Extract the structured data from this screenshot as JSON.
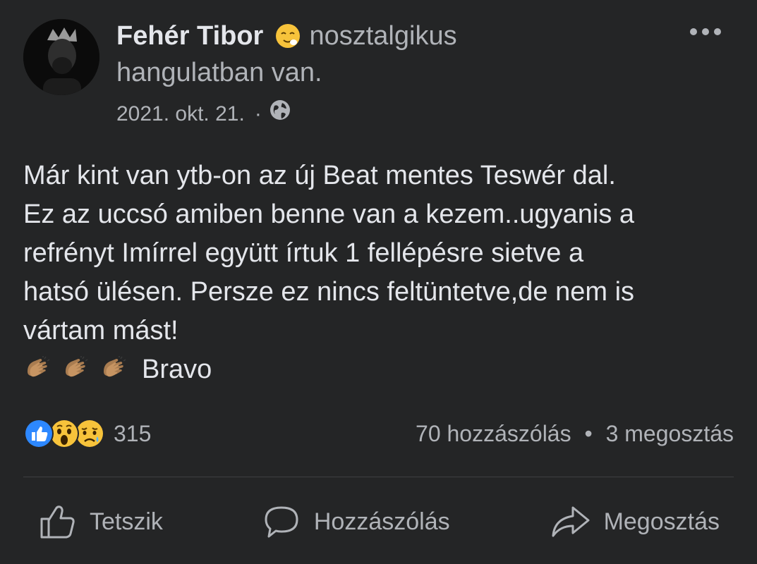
{
  "post": {
    "author": "Fehér Tibor",
    "feeling_label": "nosztalgikus",
    "feeling_suffix": "hangulatban van.",
    "date": "2021. okt. 21.",
    "separator": "·",
    "audience_icon": "globe-icon",
    "more_icon": "more-options-icon",
    "text_lines": [
      "Már kint van ytb-on az új Beat mentes Teswér dal.",
      "Ez az uccsó amiben benne van a kezem..ugyanis a",
      "refrényt Imírrel együtt írtuk 1 fellépésre sietve a",
      "hatsó ülésen. Persze ez nincs feltüntetve,de nem is",
      "vártam mást!"
    ],
    "closing_emojis": [
      "clapping-hands-emoji",
      "clapping-hands-emoji",
      "clapping-hands-emoji"
    ],
    "closing_text": "Bravo"
  },
  "reactions": {
    "icons": [
      "like-reaction-icon",
      "wow-reaction-icon",
      "sad-reaction-icon"
    ],
    "count": "315"
  },
  "stats": {
    "comments": "70 hozzászólás",
    "separator": "•",
    "shares": "3 megosztás"
  },
  "actions": {
    "like": "Tetszik",
    "comment": "Hozzászólás",
    "share": "Megosztás"
  },
  "colors": {
    "background": "#242526",
    "text_primary": "#e4e6eb",
    "text_secondary": "#b0b3b8",
    "like_blue": "#2d88ff",
    "emoji_yellow": "#f7c33b",
    "divider": "#3e4042"
  }
}
